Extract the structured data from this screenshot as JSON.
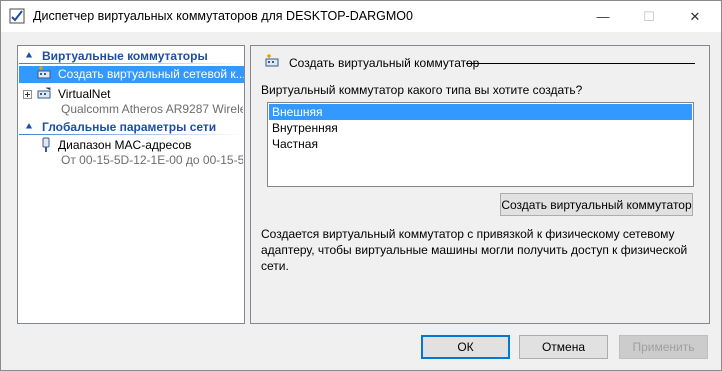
{
  "window": {
    "title": "Диспетчер виртуальных коммутаторов для DESKTOP-DARGMO0",
    "minimize_symbol": "—",
    "maximize_symbol": "☐",
    "close_symbol": "✕"
  },
  "sidebar": {
    "section_virtual_switches": "Виртуальные коммутаторы",
    "create_item": "Создать виртуальный сетевой к...",
    "virtualnet": {
      "name": "VirtualNet",
      "adapter": "Qualcomm Atheros AR9287 Wirele..."
    },
    "section_global": "Глобальные параметры сети",
    "mac_range": {
      "name": "Диапазон MAC-адресов",
      "value": "От 00-15-5D-12-1E-00 до 00-15-5..."
    }
  },
  "main": {
    "header": "Создать виртуальный коммутатор",
    "question": "Виртуальный коммутатор какого типа вы хотите создать?",
    "options": [
      "Внешняя",
      "Внутренняя",
      "Частная"
    ],
    "selected_option": "Внешняя",
    "create_button": "Создать виртуальный коммутатор",
    "description": "Создается виртуальный коммутатор с привязкой к физическому сетевому адаптеру, чтобы виртуальные машины могли получить доступ к физической сети."
  },
  "footer": {
    "ok": "ОК",
    "cancel": "Отмена",
    "apply": "Применить"
  },
  "colors": {
    "selection": "#3399ff",
    "section_header": "#1c4ea6",
    "focus_border": "#0078d7"
  }
}
